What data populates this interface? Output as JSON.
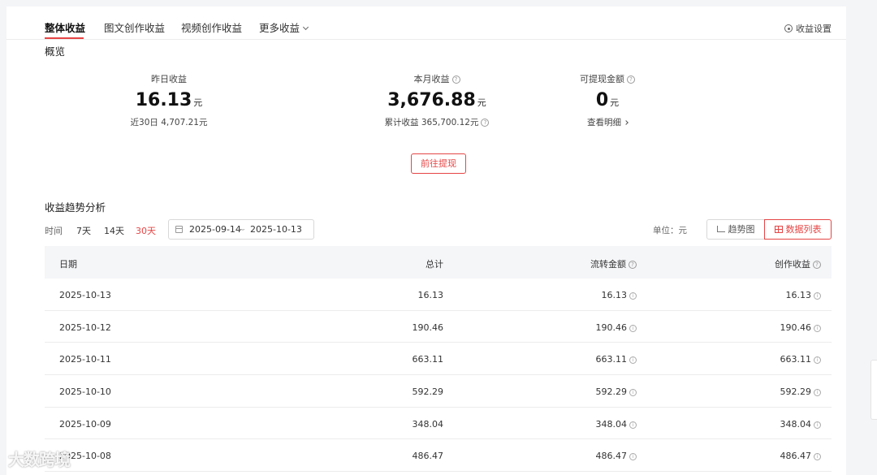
{
  "tabs": [
    {
      "label": "整体收益",
      "active": true
    },
    {
      "label": "图文创作收益",
      "active": false
    },
    {
      "label": "视频创作收益",
      "active": false
    },
    {
      "label": "更多收益",
      "active": false
    }
  ],
  "settings_label": "收益设置",
  "overview": {
    "title": "概览",
    "yesterday": {
      "label": "昨日收益",
      "value": "16.13",
      "unit": "元",
      "sub": "近30日 4,707.21元"
    },
    "month": {
      "label": "本月收益",
      "value": "3,676.88",
      "unit": "元",
      "sub": "累计收益 365,700.12元"
    },
    "withdrawable": {
      "label": "可提现金额",
      "value": "0",
      "unit": "元",
      "sub": "查看明细"
    },
    "withdraw_button": "前往提现"
  },
  "trend": {
    "title": "收益趋势分析",
    "time_label": "时间",
    "ranges": [
      "7天",
      "14天",
      "30天"
    ],
    "active_range": "30天",
    "date_start": "2025-09-14",
    "date_sep": "~",
    "date_end": "2025-10-13",
    "unit_label": "单位：元",
    "view_trend": "趋势图",
    "view_list": "数据列表"
  },
  "table": {
    "headers": [
      "日期",
      "总计",
      "流转金额",
      "创作收益"
    ],
    "rows": [
      [
        "2025-10-13",
        "16.13",
        "16.13",
        "16.13"
      ],
      [
        "2025-10-12",
        "190.46",
        "190.46",
        "190.46"
      ],
      [
        "2025-10-11",
        "663.11",
        "663.11",
        "663.11"
      ],
      [
        "2025-10-10",
        "592.29",
        "592.29",
        "592.29"
      ],
      [
        "2025-10-09",
        "348.04",
        "348.04",
        "348.04"
      ],
      [
        "2025-10-08",
        "486.47",
        "486.47",
        "486.47"
      ]
    ]
  },
  "watermark": "大数跨境",
  "colors": {
    "accent": "#e64545",
    "header_bg": "#f5f6f8",
    "page_bg": "#f4f5f7"
  }
}
